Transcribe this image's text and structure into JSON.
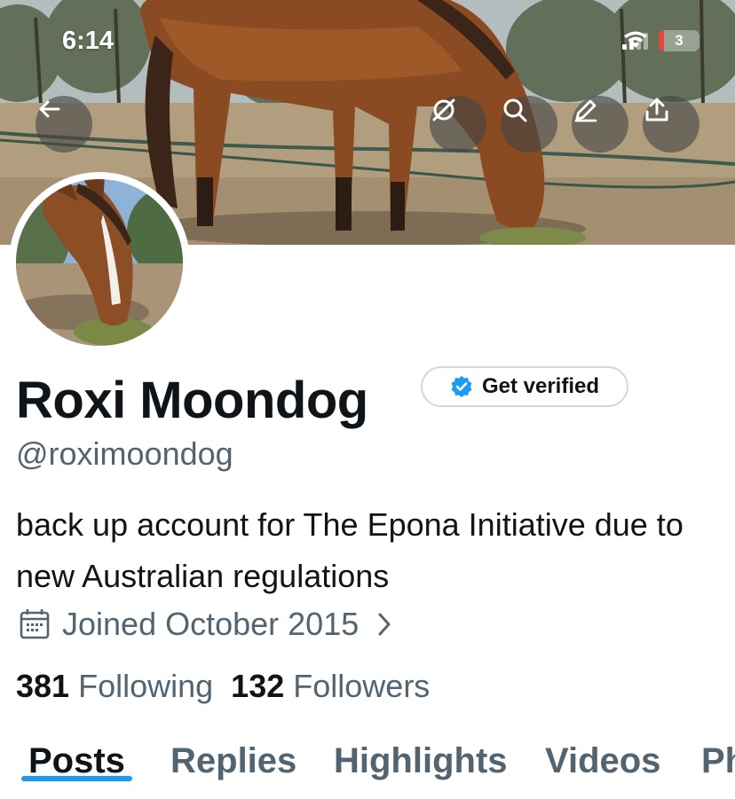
{
  "status_bar": {
    "time": "6:14",
    "battery_level": "3"
  },
  "header": {
    "buttons": [
      {
        "icon": "back-arrow-icon"
      },
      {
        "icon": "grok-icon"
      },
      {
        "icon": "search-icon"
      },
      {
        "icon": "edit-icon"
      },
      {
        "icon": "share-icon"
      }
    ]
  },
  "profile": {
    "name": "Roxi Moondog",
    "handle": "@roximoondog",
    "get_verified_label": "Get verified",
    "bio": "back up account for The Epona Initiative due to new Australian regulations",
    "joined": "Joined October 2015",
    "following_count": "381",
    "following_label": "Following",
    "followers_count": "132",
    "followers_label": "Followers"
  },
  "tabs": [
    {
      "label": "Posts",
      "active": true
    },
    {
      "label": "Replies",
      "active": false
    },
    {
      "label": "Highlights",
      "active": false
    },
    {
      "label": "Videos",
      "active": false
    },
    {
      "label": "Photos",
      "active": false
    }
  ],
  "colors": {
    "accent": "#1d9bf0",
    "text_primary": "#0f1419",
    "text_secondary": "#536471",
    "border": "#cfd9de"
  }
}
